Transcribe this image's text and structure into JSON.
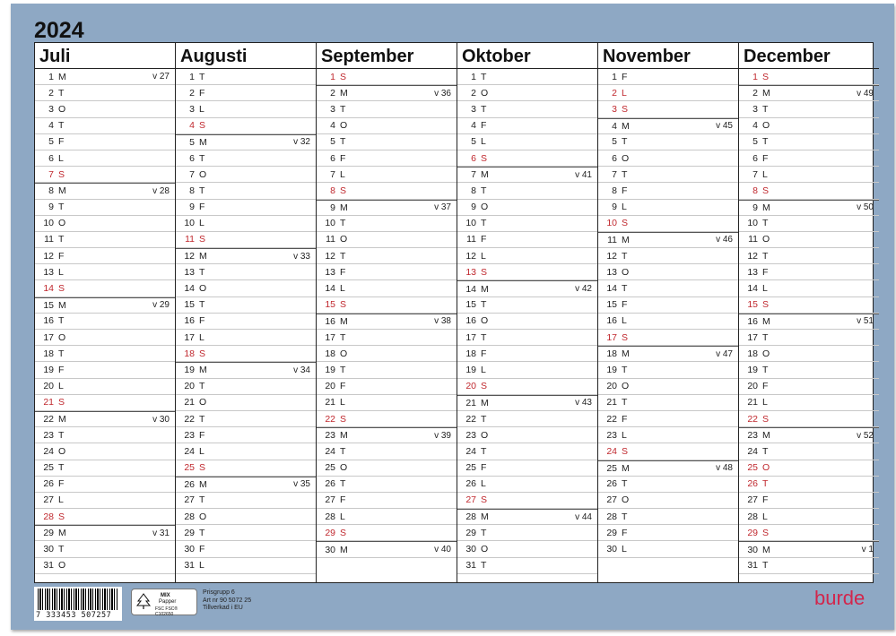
{
  "year": "2024",
  "months": [
    {
      "name": "Juli",
      "days": [
        [
          "1",
          "M",
          "v 27",
          0
        ],
        [
          "2",
          "T",
          "",
          0
        ],
        [
          "3",
          "O",
          "",
          0
        ],
        [
          "4",
          "T",
          "",
          0
        ],
        [
          "5",
          "F",
          "",
          0
        ],
        [
          "6",
          "L",
          "",
          0
        ],
        [
          "7",
          "S",
          "",
          1
        ],
        [
          "8",
          "M",
          "v 28",
          0
        ],
        [
          "9",
          "T",
          "",
          0
        ],
        [
          "10",
          "O",
          "",
          0
        ],
        [
          "11",
          "T",
          "",
          0
        ],
        [
          "12",
          "F",
          "",
          0
        ],
        [
          "13",
          "L",
          "",
          0
        ],
        [
          "14",
          "S",
          "",
          1
        ],
        [
          "15",
          "M",
          "v 29",
          0
        ],
        [
          "16",
          "T",
          "",
          0
        ],
        [
          "17",
          "O",
          "",
          0
        ],
        [
          "18",
          "T",
          "",
          0
        ],
        [
          "19",
          "F",
          "",
          0
        ],
        [
          "20",
          "L",
          "",
          0
        ],
        [
          "21",
          "S",
          "",
          1
        ],
        [
          "22",
          "M",
          "v 30",
          0
        ],
        [
          "23",
          "T",
          "",
          0
        ],
        [
          "24",
          "O",
          "",
          0
        ],
        [
          "25",
          "T",
          "",
          0
        ],
        [
          "26",
          "F",
          "",
          0
        ],
        [
          "27",
          "L",
          "",
          0
        ],
        [
          "28",
          "S",
          "",
          1
        ],
        [
          "29",
          "M",
          "v 31",
          0
        ],
        [
          "30",
          "T",
          "",
          0
        ],
        [
          "31",
          "O",
          "",
          0
        ]
      ]
    },
    {
      "name": "Augusti",
      "days": [
        [
          "1",
          "T",
          "",
          0
        ],
        [
          "2",
          "F",
          "",
          0
        ],
        [
          "3",
          "L",
          "",
          0
        ],
        [
          "4",
          "S",
          "",
          1
        ],
        [
          "5",
          "M",
          "v 32",
          0
        ],
        [
          "6",
          "T",
          "",
          0
        ],
        [
          "7",
          "O",
          "",
          0
        ],
        [
          "8",
          "T",
          "",
          0
        ],
        [
          "9",
          "F",
          "",
          0
        ],
        [
          "10",
          "L",
          "",
          0
        ],
        [
          "11",
          "S",
          "",
          1
        ],
        [
          "12",
          "M",
          "v 33",
          0
        ],
        [
          "13",
          "T",
          "",
          0
        ],
        [
          "14",
          "O",
          "",
          0
        ],
        [
          "15",
          "T",
          "",
          0
        ],
        [
          "16",
          "F",
          "",
          0
        ],
        [
          "17",
          "L",
          "",
          0
        ],
        [
          "18",
          "S",
          "",
          1
        ],
        [
          "19",
          "M",
          "v 34",
          0
        ],
        [
          "20",
          "T",
          "",
          0
        ],
        [
          "21",
          "O",
          "",
          0
        ],
        [
          "22",
          "T",
          "",
          0
        ],
        [
          "23",
          "F",
          "",
          0
        ],
        [
          "24",
          "L",
          "",
          0
        ],
        [
          "25",
          "S",
          "",
          1
        ],
        [
          "26",
          "M",
          "v 35",
          0
        ],
        [
          "27",
          "T",
          "",
          0
        ],
        [
          "28",
          "O",
          "",
          0
        ],
        [
          "29",
          "T",
          "",
          0
        ],
        [
          "30",
          "F",
          "",
          0
        ],
        [
          "31",
          "L",
          "",
          0
        ]
      ]
    },
    {
      "name": "September",
      "days": [
        [
          "1",
          "S",
          "",
          1
        ],
        [
          "2",
          "M",
          "v 36",
          0
        ],
        [
          "3",
          "T",
          "",
          0
        ],
        [
          "4",
          "O",
          "",
          0
        ],
        [
          "5",
          "T",
          "",
          0
        ],
        [
          "6",
          "F",
          "",
          0
        ],
        [
          "7",
          "L",
          "",
          0
        ],
        [
          "8",
          "S",
          "",
          1
        ],
        [
          "9",
          "M",
          "v 37",
          0
        ],
        [
          "10",
          "T",
          "",
          0
        ],
        [
          "11",
          "O",
          "",
          0
        ],
        [
          "12",
          "T",
          "",
          0
        ],
        [
          "13",
          "F",
          "",
          0
        ],
        [
          "14",
          "L",
          "",
          0
        ],
        [
          "15",
          "S",
          "",
          1
        ],
        [
          "16",
          "M",
          "v 38",
          0
        ],
        [
          "17",
          "T",
          "",
          0
        ],
        [
          "18",
          "O",
          "",
          0
        ],
        [
          "19",
          "T",
          "",
          0
        ],
        [
          "20",
          "F",
          "",
          0
        ],
        [
          "21",
          "L",
          "",
          0
        ],
        [
          "22",
          "S",
          "",
          1
        ],
        [
          "23",
          "M",
          "v 39",
          0
        ],
        [
          "24",
          "T",
          "",
          0
        ],
        [
          "25",
          "O",
          "",
          0
        ],
        [
          "26",
          "T",
          "",
          0
        ],
        [
          "27",
          "F",
          "",
          0
        ],
        [
          "28",
          "L",
          "",
          0
        ],
        [
          "29",
          "S",
          "",
          1
        ],
        [
          "30",
          "M",
          "v 40",
          0
        ]
      ]
    },
    {
      "name": "Oktober",
      "days": [
        [
          "1",
          "T",
          "",
          0
        ],
        [
          "2",
          "O",
          "",
          0
        ],
        [
          "3",
          "T",
          "",
          0
        ],
        [
          "4",
          "F",
          "",
          0
        ],
        [
          "5",
          "L",
          "",
          0
        ],
        [
          "6",
          "S",
          "",
          1
        ],
        [
          "7",
          "M",
          "v 41",
          0
        ],
        [
          "8",
          "T",
          "",
          0
        ],
        [
          "9",
          "O",
          "",
          0
        ],
        [
          "10",
          "T",
          "",
          0
        ],
        [
          "11",
          "F",
          "",
          0
        ],
        [
          "12",
          "L",
          "",
          0
        ],
        [
          "13",
          "S",
          "",
          1
        ],
        [
          "14",
          "M",
          "v 42",
          0
        ],
        [
          "15",
          "T",
          "",
          0
        ],
        [
          "16",
          "O",
          "",
          0
        ],
        [
          "17",
          "T",
          "",
          0
        ],
        [
          "18",
          "F",
          "",
          0
        ],
        [
          "19",
          "L",
          "",
          0
        ],
        [
          "20",
          "S",
          "",
          1
        ],
        [
          "21",
          "M",
          "v 43",
          0
        ],
        [
          "22",
          "T",
          "",
          0
        ],
        [
          "23",
          "O",
          "",
          0
        ],
        [
          "24",
          "T",
          "",
          0
        ],
        [
          "25",
          "F",
          "",
          0
        ],
        [
          "26",
          "L",
          "",
          0
        ],
        [
          "27",
          "S",
          "",
          1
        ],
        [
          "28",
          "M",
          "v 44",
          0
        ],
        [
          "29",
          "T",
          "",
          0
        ],
        [
          "30",
          "O",
          "",
          0
        ],
        [
          "31",
          "T",
          "",
          0
        ]
      ]
    },
    {
      "name": "November",
      "days": [
        [
          "1",
          "F",
          "",
          0
        ],
        [
          "2",
          "L",
          "",
          1
        ],
        [
          "3",
          "S",
          "",
          1
        ],
        [
          "4",
          "M",
          "v 45",
          0
        ],
        [
          "5",
          "T",
          "",
          0
        ],
        [
          "6",
          "O",
          "",
          0
        ],
        [
          "7",
          "T",
          "",
          0
        ],
        [
          "8",
          "F",
          "",
          0
        ],
        [
          "9",
          "L",
          "",
          0
        ],
        [
          "10",
          "S",
          "",
          1
        ],
        [
          "11",
          "M",
          "v 46",
          0
        ],
        [
          "12",
          "T",
          "",
          0
        ],
        [
          "13",
          "O",
          "",
          0
        ],
        [
          "14",
          "T",
          "",
          0
        ],
        [
          "15",
          "F",
          "",
          0
        ],
        [
          "16",
          "L",
          "",
          0
        ],
        [
          "17",
          "S",
          "",
          1
        ],
        [
          "18",
          "M",
          "v 47",
          0
        ],
        [
          "19",
          "T",
          "",
          0
        ],
        [
          "20",
          "O",
          "",
          0
        ],
        [
          "21",
          "T",
          "",
          0
        ],
        [
          "22",
          "F",
          "",
          0
        ],
        [
          "23",
          "L",
          "",
          0
        ],
        [
          "24",
          "S",
          "",
          1
        ],
        [
          "25",
          "M",
          "v 48",
          0
        ],
        [
          "26",
          "T",
          "",
          0
        ],
        [
          "27",
          "O",
          "",
          0
        ],
        [
          "28",
          "T",
          "",
          0
        ],
        [
          "29",
          "F",
          "",
          0
        ],
        [
          "30",
          "L",
          "",
          0
        ]
      ]
    },
    {
      "name": "December",
      "days": [
        [
          "1",
          "S",
          "",
          1
        ],
        [
          "2",
          "M",
          "v 49",
          0
        ],
        [
          "3",
          "T",
          "",
          0
        ],
        [
          "4",
          "O",
          "",
          0
        ],
        [
          "5",
          "T",
          "",
          0
        ],
        [
          "6",
          "F",
          "",
          0
        ],
        [
          "7",
          "L",
          "",
          0
        ],
        [
          "8",
          "S",
          "",
          1
        ],
        [
          "9",
          "M",
          "v 50",
          0
        ],
        [
          "10",
          "T",
          "",
          0
        ],
        [
          "11",
          "O",
          "",
          0
        ],
        [
          "12",
          "T",
          "",
          0
        ],
        [
          "13",
          "F",
          "",
          0
        ],
        [
          "14",
          "L",
          "",
          0
        ],
        [
          "15",
          "S",
          "",
          1
        ],
        [
          "16",
          "M",
          "v 51",
          0
        ],
        [
          "17",
          "T",
          "",
          0
        ],
        [
          "18",
          "O",
          "",
          0
        ],
        [
          "19",
          "T",
          "",
          0
        ],
        [
          "20",
          "F",
          "",
          0
        ],
        [
          "21",
          "L",
          "",
          0
        ],
        [
          "22",
          "S",
          "",
          1
        ],
        [
          "23",
          "M",
          "v 52",
          0
        ],
        [
          "24",
          "T",
          "",
          0
        ],
        [
          "25",
          "O",
          "",
          1
        ],
        [
          "26",
          "T",
          "",
          1
        ],
        [
          "27",
          "F",
          "",
          0
        ],
        [
          "28",
          "L",
          "",
          0
        ],
        [
          "29",
          "S",
          "",
          1
        ],
        [
          "30",
          "M",
          "v 1",
          0
        ],
        [
          "31",
          "T",
          "",
          0
        ]
      ]
    }
  ],
  "footer": {
    "barcode_number": "7 333453 507257",
    "fsc_line1": "MIX",
    "fsc_line2": "Papper",
    "fsc_line3": "FSC FSC® C102650",
    "info_line1": "Prisgrupp 6",
    "info_line2": "Art nr 90 5072 25",
    "info_line3": "Tillverkad i EU",
    "brand": "burde"
  },
  "colors": {
    "holiday_red": "#c0282e",
    "background_blue": "#8ea8c4",
    "brand_pink": "#d2264c"
  }
}
